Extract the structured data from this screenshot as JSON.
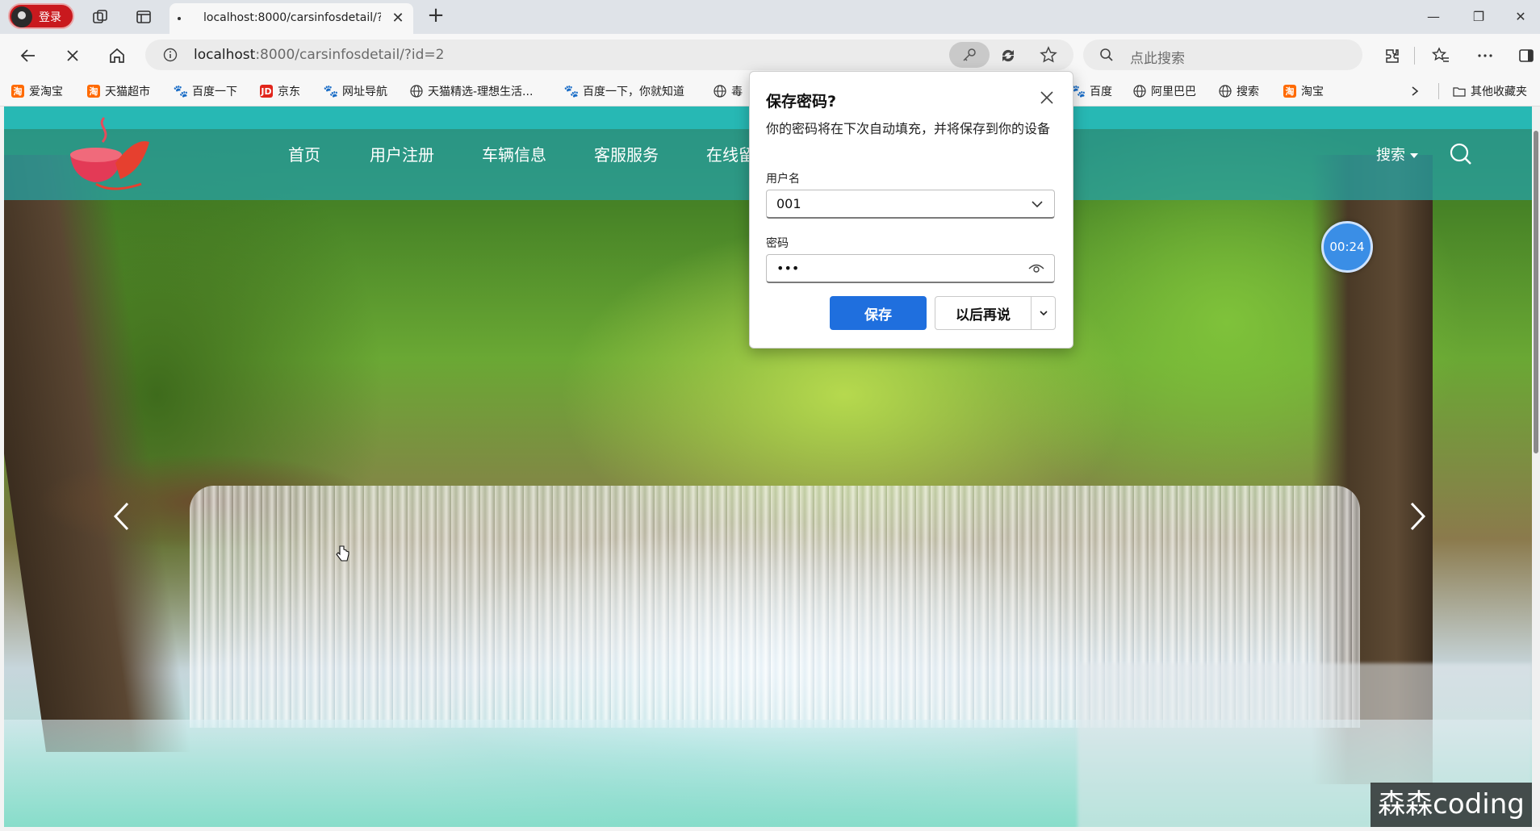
{
  "browser": {
    "profile_label": "登录",
    "tab_title": "localhost:8000/carsinfosdetail/?id",
    "url_host": "localhost",
    "url_rest": ":8000/carsinfosdetail/?id=2",
    "search_placeholder": "点此搜索"
  },
  "bookmarks": [
    {
      "label": "爱淘宝",
      "icon": "taobao-icon"
    },
    {
      "label": "天猫超市",
      "icon": "taobao-icon"
    },
    {
      "label": "百度一下",
      "icon": "baidu-paw-icon"
    },
    {
      "label": "京东",
      "icon": "jd-icon"
    },
    {
      "label": "网址导航",
      "icon": "baidu-paw-icon"
    },
    {
      "label": "天猫精选-理想生活...",
      "icon": "globe-icon"
    },
    {
      "label": "百度一下，你就知道",
      "icon": "baidu-paw-icon"
    },
    {
      "label": "毒",
      "icon": "globe-icon"
    },
    {
      "label": "百度",
      "icon": "baidu-paw-icon"
    },
    {
      "label": "阿里巴巴",
      "icon": "globe-icon"
    },
    {
      "label": "搜索",
      "icon": "globe-icon"
    },
    {
      "label": "淘宝",
      "icon": "taobao-icon"
    }
  ],
  "other_bookmarks": "其他收藏夹",
  "site": {
    "nav": [
      "首页",
      "用户注册",
      "车辆信息",
      "客服服务",
      "在线留"
    ],
    "search_label": "搜索",
    "timer": "00:24",
    "watermark": "森森coding"
  },
  "dialog": {
    "title": "保存密码?",
    "description": "你的密码将在下次自动填充，并将保存到你的设备",
    "username_label": "用户名",
    "username_value": "001",
    "password_label": "密码",
    "password_value": "•••",
    "save_label": "保存",
    "later_label": "以后再说"
  },
  "colors": {
    "header_teal": "#27b8b4",
    "save_blue": "#1f6fde",
    "timer_blue": "#3a8ee6"
  }
}
